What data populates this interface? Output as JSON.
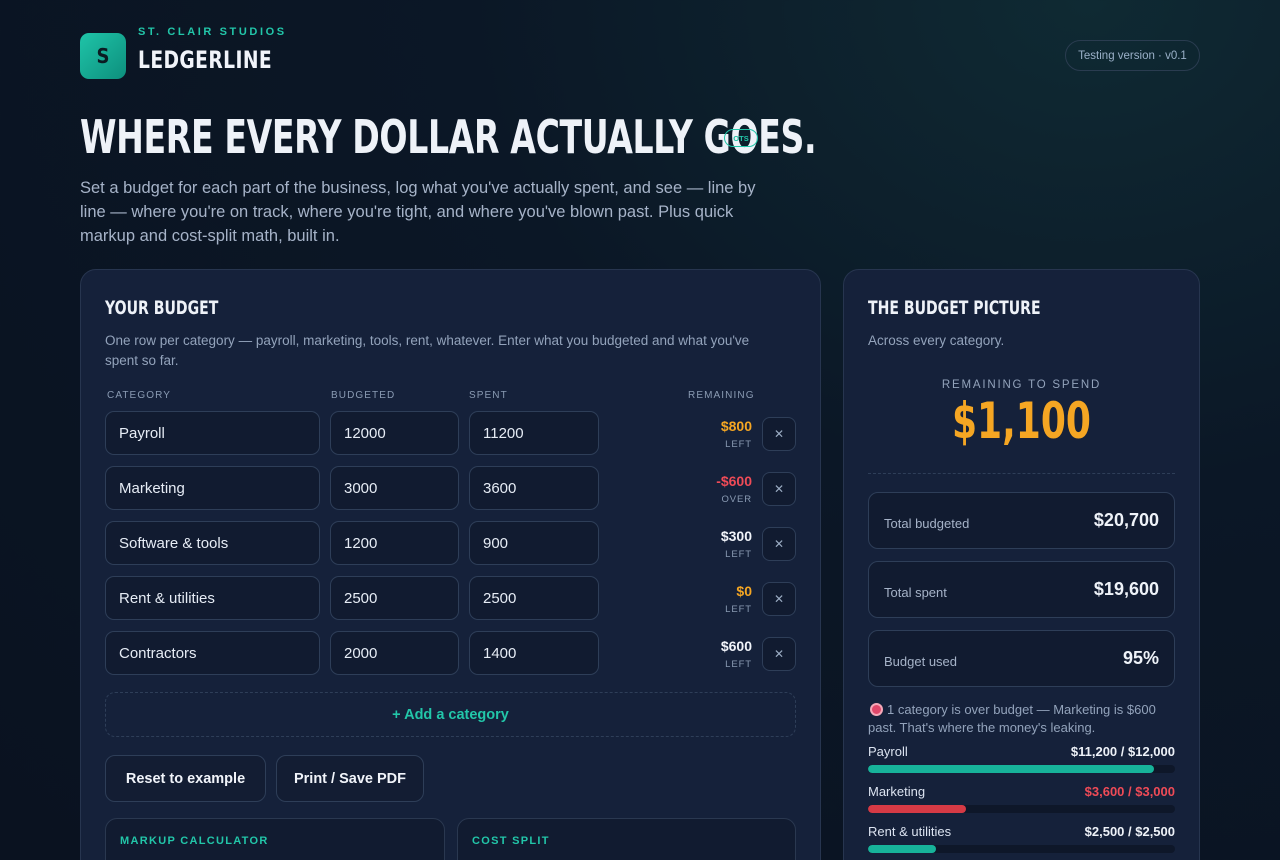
{
  "brand": {
    "logo_letter": "S",
    "studio": "ST. CLAIR STUDIOS",
    "app_name": "LEDGERLINE",
    "version": "Testing version · v0.1"
  },
  "hero": {
    "title": "WHERE EVERY DOLLAR ACTUALLY GOES.",
    "badge": "OTS",
    "description": "Set a budget for each part of the business, log what you've actually spent, and see — line by line — where you're on track, where you're tight, and where you've blown past. Plus quick markup and cost-split math, built in."
  },
  "budget": {
    "title": "YOUR BUDGET",
    "subtitle": "One row per category — payroll, marketing, tools, rent, whatever. Enter what you budgeted and what you've spent so far.",
    "columns": {
      "category": "CATEGORY",
      "budgeted": "BUDGETED",
      "spent": "SPENT",
      "remaining": "REMAINING"
    },
    "rows": [
      {
        "category": "Payroll",
        "budgeted": "12000",
        "spent": "11200",
        "remaining": "$800",
        "status": "LEFT",
        "color": "#f5a623"
      },
      {
        "category": "Marketing",
        "budgeted": "3000",
        "spent": "3600",
        "remaining": "-$600",
        "status": "OVER",
        "color": "#ef4b57"
      },
      {
        "category": "Software & tools",
        "budgeted": "1200",
        "spent": "900",
        "remaining": "$300",
        "status": "LEFT",
        "color": "#f1f4fa"
      },
      {
        "category": "Rent & utilities",
        "budgeted": "2500",
        "spent": "2500",
        "remaining": "$0",
        "status": "LEFT",
        "color": "#f5a623"
      },
      {
        "category": "Contractors",
        "budgeted": "2000",
        "spent": "1400",
        "remaining": "$600",
        "status": "LEFT",
        "color": "#f1f4fa"
      }
    ],
    "remove_icon": "close-icon",
    "add_label": "+ Add a category",
    "reset_label": "Reset to example",
    "print_label": "Print / Save PDF",
    "markup_label": "MARKUP CALCULATOR",
    "split_label": "COST SPLIT"
  },
  "picture": {
    "title": "THE BUDGET PICTURE",
    "subtitle": "Across every category.",
    "remaining_label": "REMAINING TO SPEND",
    "remaining_value": "$1,100",
    "stats": [
      {
        "label": "Total budgeted",
        "value": "$20,700"
      },
      {
        "label": "Total spent",
        "value": "$19,600"
      },
      {
        "label": "Budget used",
        "value": "95%"
      }
    ],
    "alert": "1 category is over budget — Marketing is $600 past. That's where the money's leaking.",
    "bars": [
      {
        "name": "Payroll",
        "value_text": "$11,200 / $12,000",
        "fraction": 0.933,
        "color": "#17b39a",
        "text_color": "#eef2f8"
      },
      {
        "name": "Marketing",
        "value_text": "$3,600 / $3,000",
        "fraction": 0.32,
        "color": "#d63a45",
        "text_color": "#ef4b57"
      },
      {
        "name": "Rent & utilities",
        "value_text": "$2,500 / $2,500",
        "fraction": 0.22,
        "color": "#17b39a",
        "text_color": "#eef2f8"
      }
    ],
    "colors": {
      "accent": "#22c6a9",
      "warning": "#f5a623",
      "danger": "#ef4b57"
    }
  }
}
